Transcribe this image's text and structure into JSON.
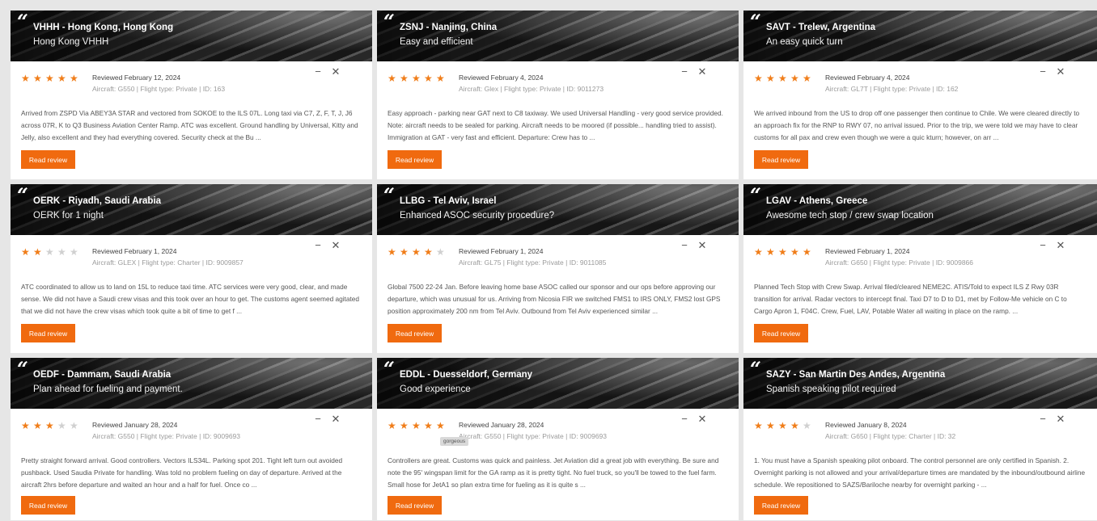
{
  "ui": {
    "read_label": "Read review",
    "minimize_icon": "minus-icon",
    "close_icon": "close-icon",
    "quote_icon": "quote-icon",
    "minimize_glyph": "−",
    "close_glyph": "✕",
    "quote_glyph": "“",
    "accent_color": "#f06a0f",
    "star_color": "#f07d19"
  },
  "reviews": [
    {
      "airport": "VHHH - Hong Kong, Hong Kong",
      "title": "Hong Kong VHHH",
      "rating": 5,
      "reviewed": "Reviewed February 12, 2024",
      "meta": "Aircraft: G550 | Flight type: Private | ID: 163",
      "text": "Arrived from ZSPD Via ABEY3A STAR and vectored from SOKOE to the ILS 07L. Long taxi via C7, Z, F, T, J, J6 across 07R, K to Q3 Business Aviation Center Ramp. ATC was excellent. Ground handling by Universal, Kitty and Jelly, also excellent and they had everything covered. Security check at the Bu ..."
    },
    {
      "airport": "ZSNJ - Nanjing, China",
      "title": "Easy and efficient",
      "rating": 5,
      "reviewed": "Reviewed February 4, 2024",
      "meta": "Aircraft: Glex | Flight type: Private | ID: 9011273",
      "text": "Easy approach - parking near GAT next to C8 taxiway. We used Universal Handling - very good service provided. Note: aircraft needs to be sealed for parking. Aircraft needs to be moored (if possible... handling tried to assist). Immigration at GAT - very fast and efficient. Departure: Crew has to ..."
    },
    {
      "airport": "SAVT - Trelew, Argentina",
      "title": "An easy quick turn",
      "rating": 5,
      "reviewed": "Reviewed February 4, 2024",
      "meta": "Aircraft: GL7T | Flight type: Private | ID: 162",
      "text": "We arrived inbound from the US to drop off one passenger then continue to Chile. We were cleared directly to an approach fix for the RNP to RWY 07, no arrival issued. Prior to the trip, we were told we may have to clear customs for all pax and crew even though we were a quic kturn; however, on arr ..."
    },
    {
      "airport": "OERK - Riyadh, Saudi Arabia",
      "title": "OERK for 1 night",
      "rating": 2,
      "reviewed": "Reviewed February 1, 2024",
      "meta": "Aircraft: GLEX | Flight type: Charter | ID: 9009857",
      "text": "ATC coordinated to allow us to land on 15L to reduce taxi time. ATC services were very good, clear, and made sense. We did not have a Saudi crew visas and this took over an hour to get. The customs agent seemed agitated that we did not have the crew visas which took quite a bit of time to get f ..."
    },
    {
      "airport": "LLBG - Tel Aviv, Israel",
      "title": "Enhanced ASOC security procedure?",
      "rating": 4,
      "reviewed": "Reviewed February 1, 2024",
      "meta": "Aircraft: GL75 | Flight type: Private | ID: 9011085",
      "text": "Global 7500 22-24 Jan. Before leaving home base ASOC called our sponsor and our ops before approving our departure, which was unusual for us. Arriving from Nicosia FIR we switched FMS1 to IRS ONLY, FMS2 lost GPS position approximately 200 nm from Tel Aviv. Outbound from Tel Aviv experienced similar ..."
    },
    {
      "airport": "LGAV - Athens, Greece",
      "title": "Awesome tech stop / crew swap location",
      "rating": 5,
      "reviewed": "Reviewed February 1, 2024",
      "meta": "Aircraft: G650 | Flight type: Private | ID: 9009866",
      "text": "Planned Tech Stop with Crew Swap. Arrival filed/cleared NEME2C. ATIS/Told to expect ILS Z Rwy 03R transition for arrival. Radar vectors to intercept final. Taxi D7 to D to D1, met by Follow-Me vehicle on C to Cargo Apron 1, F04C. Crew, Fuel, LAV, Potable Water all waiting in place on the ramp. ..."
    },
    {
      "airport": "OEDF - Dammam, Saudi Arabia",
      "title": "Plan ahead for fueling and payment.",
      "rating": 3,
      "reviewed": "Reviewed January 28, 2024",
      "meta": "Aircraft: G550 | Flight type: Private | ID: 9009693",
      "text": "Pretty straight forward arrival. Good controllers. Vectors ILS34L. Parking spot 201. Tight left turn out avoided pushback. Used Saudia Private for handling. Was told no problem fueling on day of departure. Arrived at the aircraft 2hrs before departure and waited an hour and a half for fuel. Once co ..."
    },
    {
      "airport": "EDDL - Duesseldorf, Germany",
      "title": "Good experience",
      "rating": 5,
      "reviewed": "Reviewed January 28, 2024",
      "meta": "Aircraft: G550 | Flight type: Private | ID: 9009693",
      "tooltip": "gorgeous",
      "text": "Controllers are great. Customs was quick and painless. Jet Aviation did a great job with everything. Be sure and note the 95' wingspan limit for the GA ramp as it is pretty tight. No fuel truck, so you'll be towed to the fuel farm. Small hose for JetA1 so plan extra time for fueling as it is quite s ..."
    },
    {
      "airport": "SAZY - San Martin Des Andes, Argentina",
      "title": "Spanish speaking pilot required",
      "rating": 4,
      "reviewed": "Reviewed January 8, 2024",
      "meta": "Aircraft: G650 | Flight type: Charter | ID: 32",
      "text": "1. You must have a Spanish speaking pilot onboard. The control personnel are only certified in Spanish. 2. Overnight parking is not allowed and your arrival/departure times are mandated by the inbound/outbound airline schedule. We repositioned to SAZS/Bariloche nearby for overnight parking - ..."
    }
  ]
}
